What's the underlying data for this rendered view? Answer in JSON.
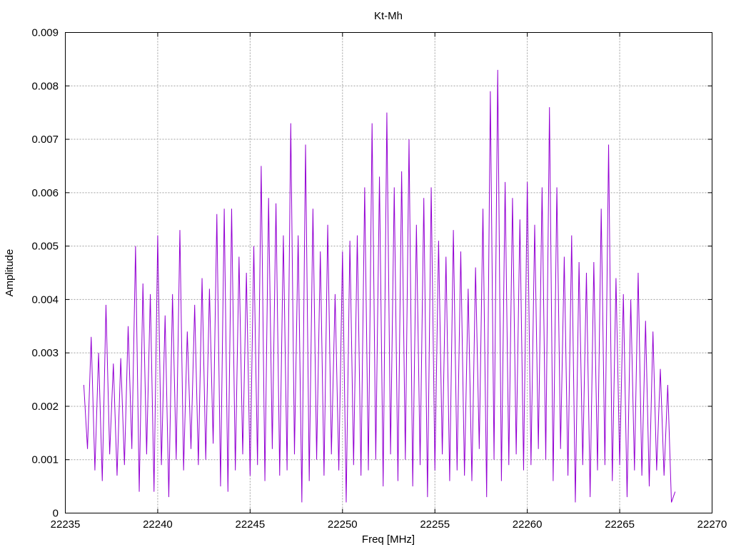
{
  "chart_data": {
    "type": "line",
    "title": "Kt-Mh",
    "xlabel": "Freq [MHz]",
    "ylabel": "Amplitude",
    "xlim": [
      22235,
      22270
    ],
    "ylim": [
      0,
      0.009
    ],
    "xticks": [
      22235,
      22240,
      22245,
      22250,
      22255,
      22260,
      22265,
      22270
    ],
    "yticks": [
      0,
      0.001,
      0.002,
      0.003,
      0.004,
      0.005,
      0.006,
      0.007,
      0.008,
      0.009
    ],
    "xtick_labels": [
      "22235",
      "22240",
      "22245",
      "22250",
      "22255",
      "22260",
      "22265",
      "22270"
    ],
    "ytick_labels": [
      "0",
      "0.001",
      "0.002",
      "0.003",
      "0.004",
      "0.005",
      "0.006",
      "0.007",
      "0.008",
      "0.009"
    ],
    "grid": true,
    "legend": "none",
    "series": [
      {
        "name": "Kt-Mh",
        "color": "#9400d3",
        "x_start": 22236.0,
        "x_step": 0.2,
        "values": [
          0.0024,
          0.0012,
          0.0033,
          0.0008,
          0.003,
          0.0006,
          0.0039,
          0.0011,
          0.0028,
          0.0007,
          0.0029,
          0.0009,
          0.0035,
          0.0012,
          0.005,
          0.0004,
          0.0043,
          0.0011,
          0.0041,
          0.0004,
          0.0052,
          0.0009,
          0.0037,
          0.0003,
          0.0041,
          0.001,
          0.0053,
          0.0008,
          0.0034,
          0.0012,
          0.0039,
          0.0009,
          0.0044,
          0.001,
          0.0042,
          0.0013,
          0.0056,
          0.0005,
          0.0057,
          0.0004,
          0.0057,
          0.0008,
          0.0048,
          0.0011,
          0.0045,
          0.0007,
          0.005,
          0.0009,
          0.0065,
          0.0006,
          0.0059,
          0.0012,
          0.0058,
          0.0007,
          0.0052,
          0.0008,
          0.0073,
          0.0011,
          0.0052,
          0.0002,
          0.0069,
          0.0006,
          0.0057,
          0.001,
          0.0049,
          0.0007,
          0.0054,
          0.0011,
          0.0041,
          0.0008,
          0.0049,
          0.0002,
          0.0051,
          0.0009,
          0.0052,
          0.0007,
          0.0061,
          0.0008,
          0.0073,
          0.001,
          0.0063,
          0.0005,
          0.0075,
          0.0011,
          0.0061,
          0.0006,
          0.0064,
          0.001,
          0.007,
          0.0005,
          0.0054,
          0.0009,
          0.0059,
          0.0003,
          0.0061,
          0.0008,
          0.0051,
          0.0011,
          0.0048,
          0.0006,
          0.0053,
          0.0008,
          0.0049,
          0.0007,
          0.0042,
          0.0006,
          0.0046,
          0.0012,
          0.0057,
          0.0003,
          0.0079,
          0.001,
          0.0083,
          0.0006,
          0.0062,
          0.0009,
          0.0059,
          0.0011,
          0.0055,
          0.0008,
          0.0062,
          0.0009,
          0.0054,
          0.0012,
          0.0061,
          0.001,
          0.0076,
          0.0006,
          0.0061,
          0.0012,
          0.0048,
          0.0007,
          0.0052,
          0.0002,
          0.0047,
          0.0009,
          0.0045,
          0.0003,
          0.0047,
          0.0008,
          0.0057,
          0.0009,
          0.0069,
          0.0006,
          0.0044,
          0.0009,
          0.0041,
          0.0003,
          0.004,
          0.0008,
          0.0045,
          0.0007,
          0.0036,
          0.0005,
          0.0034,
          0.0008,
          0.0027,
          0.0007,
          0.0024,
          0.0002,
          0.0004
        ]
      }
    ]
  }
}
